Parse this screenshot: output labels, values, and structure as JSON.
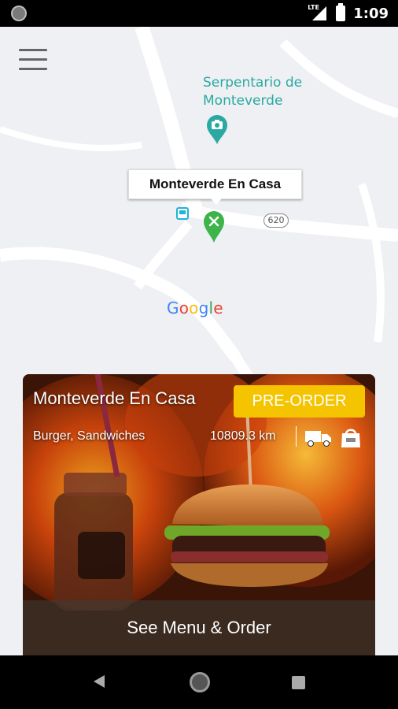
{
  "status_bar": {
    "network_label": "LTE",
    "time": "1:09",
    "icons": [
      "notification-dot-icon",
      "signal-icon",
      "battery-icon"
    ]
  },
  "map": {
    "poi": {
      "name_line1": "Serpentario de",
      "name_line2": "Monteverde",
      "icon": "camera-pin-icon",
      "color": "#2aa9a2"
    },
    "selected_place": {
      "name": "Monteverde En Casa",
      "icon": "restaurant-pin-icon",
      "color": "#3db44a"
    },
    "route_number": "620",
    "attribution": [
      "G",
      "o",
      "o",
      "g",
      "l",
      "e"
    ],
    "attribution_colors": [
      "#4285f4",
      "#ea4335",
      "#fbbc05",
      "#4285f4",
      "#34a853",
      "#ea4335"
    ]
  },
  "restaurant_card": {
    "name": "Monteverde En Casa",
    "cuisine": "Burger, Sandwiches",
    "distance": "10809.3 km",
    "preorder_label": "PRE-ORDER",
    "cta_label": "See Menu & Order",
    "service_icons": [
      "delivery-truck-icon",
      "takeaway-bag-icon"
    ],
    "accent_color": "#f5c400"
  },
  "nav_bar": {
    "icons": [
      "back-icon",
      "home-icon",
      "recents-icon"
    ]
  }
}
